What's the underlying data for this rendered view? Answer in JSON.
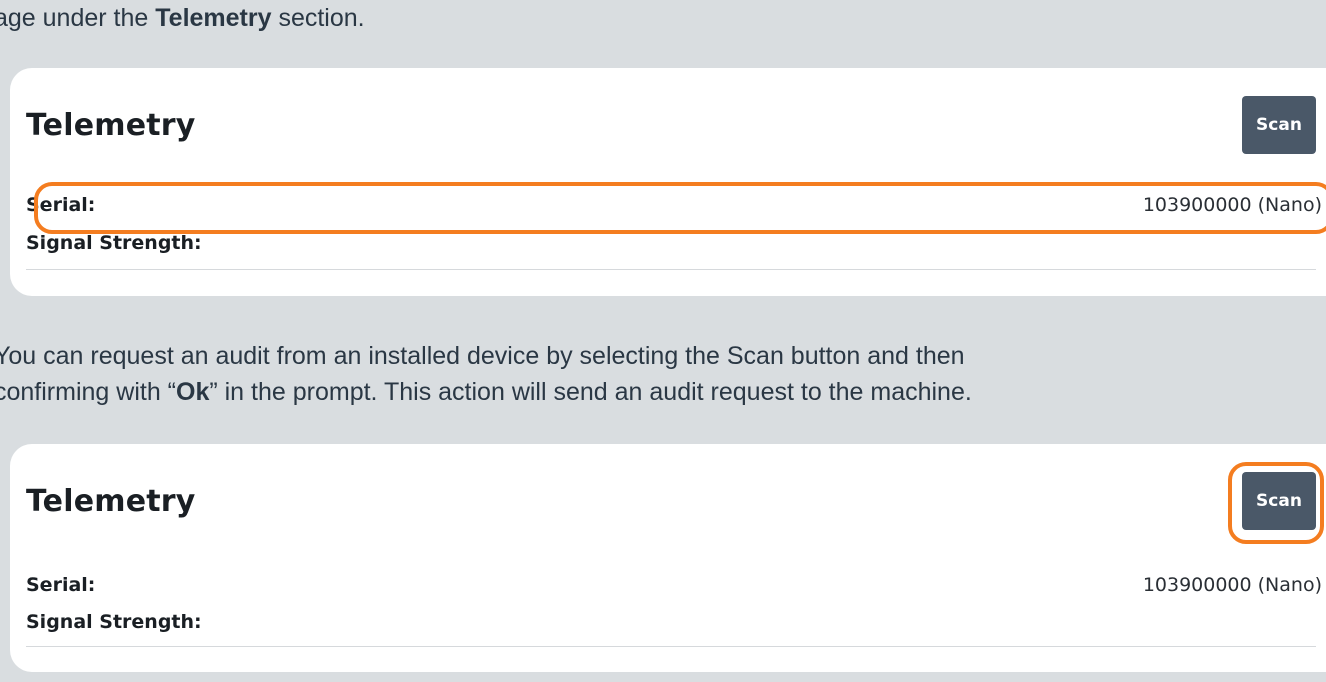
{
  "intro": {
    "prefix": "age under the ",
    "bold": "Telemetry",
    "suffix": " section."
  },
  "explain": {
    "line1": "You can request an audit from an installed device by selecting the Scan button and then",
    "line2_prefix": "confirming with “",
    "line2_bold": "Ok",
    "line2_suffix": "” in the prompt. This action will send an audit request to the machine."
  },
  "panels": [
    {
      "title": "Telemetry",
      "scan_label": "Scan",
      "serial_label": "Serial:",
      "serial_value": "103900000 (Nano)",
      "signal_label": "Signal Strength:",
      "signal_value": ""
    },
    {
      "title": "Telemetry",
      "scan_label": "Scan",
      "serial_label": "Serial:",
      "serial_value": "103900000 (Nano)",
      "signal_label": "Signal Strength:",
      "signal_value": ""
    }
  ],
  "colors": {
    "background": "#d9dde0",
    "panel": "#ffffff",
    "button": "#4a5868",
    "highlight": "#f47d20"
  }
}
